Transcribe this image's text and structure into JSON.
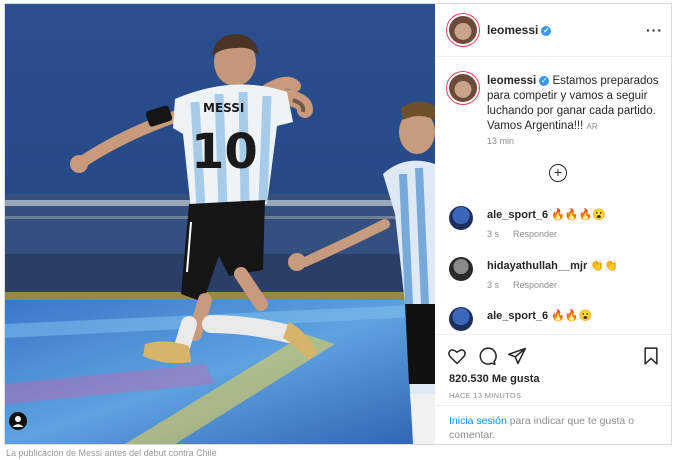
{
  "post": {
    "username": "leomessi",
    "more_glyph": "···",
    "caption_text": "Estamos preparados para competir y vamos a seguir luchando por ganar cada partido. Vamos Argentina!!!",
    "caption_badge": "AR",
    "time": "13 min",
    "jersey_name": "MESSI",
    "jersey_number": "10"
  },
  "comments": [
    {
      "user": "ale_sport_6",
      "text": "🔥🔥🔥😮",
      "age": "3 s",
      "reply": "Responder"
    },
    {
      "user": "hidayathullah__mjr",
      "text": "👏👏",
      "age": "3 s",
      "reply": "Responder"
    },
    {
      "user": "ale_sport_6",
      "text": "🔥🔥😮"
    }
  ],
  "engagement": {
    "likes": "820.530 Me gusta",
    "posted_ago": "HACE 13 MINUTOS",
    "login_link": "Inicia sesión",
    "login_text": " para indicar que te gusta o comentar."
  },
  "footer": {
    "caption_fragment": "La publicación de Messi antes del debut contra Chile"
  },
  "colors": {
    "verified": "#3897f0",
    "link": "#0095f6",
    "muted": "#8e8e8e",
    "jersey_stripe": "#75aadb"
  },
  "icons": [
    "verified-icon",
    "more-icon",
    "add-icon",
    "heart-icon",
    "comment-icon",
    "share-icon",
    "bookmark-icon",
    "user-tag-icon"
  ]
}
